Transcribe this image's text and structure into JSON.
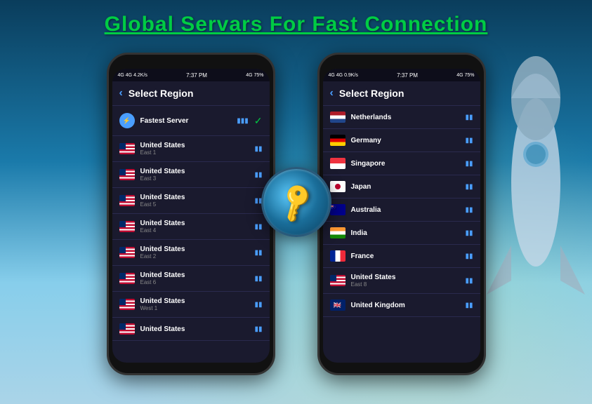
{
  "title": "Global Servars For Fast Connection",
  "phone_left": {
    "status": {
      "left": "4G  4G  4.2K/s",
      "time": "7:37 PM",
      "right": "4G  75%"
    },
    "header": {
      "back": "‹",
      "title": "Select Region"
    },
    "items": [
      {
        "id": "fastest",
        "name": "Fastest Server",
        "sub": "",
        "flag": "speed",
        "active": true
      },
      {
        "id": "us-east1",
        "name": "United States",
        "sub": "East 1",
        "flag": "us"
      },
      {
        "id": "us-east3",
        "name": "United States",
        "sub": "East 3",
        "flag": "us"
      },
      {
        "id": "us-east5",
        "name": "United States",
        "sub": "East 5",
        "flag": "us"
      },
      {
        "id": "us-east4",
        "name": "United States",
        "sub": "East 4",
        "flag": "us"
      },
      {
        "id": "us-east2",
        "name": "United States",
        "sub": "East 2",
        "flag": "us"
      },
      {
        "id": "us-east6",
        "name": "United States",
        "sub": "East 6",
        "flag": "us"
      },
      {
        "id": "us-west1",
        "name": "United States",
        "sub": "West 1",
        "flag": "us"
      },
      {
        "id": "us-more",
        "name": "United States",
        "sub": "",
        "flag": "us"
      }
    ]
  },
  "phone_right": {
    "status": {
      "left": "4G  4G  0.9K/s",
      "time": "7:37 PM",
      "right": "4G  75%"
    },
    "header": {
      "back": "‹",
      "title": "Select Region"
    },
    "items": [
      {
        "id": "nl",
        "name": "Netherlands",
        "sub": "",
        "flag": "nl"
      },
      {
        "id": "de",
        "name": "Germany",
        "sub": "",
        "flag": "de"
      },
      {
        "id": "sg",
        "name": "Singapore",
        "sub": "",
        "flag": "sg"
      },
      {
        "id": "jp",
        "name": "Japan",
        "sub": "",
        "flag": "jp"
      },
      {
        "id": "au",
        "name": "Australia",
        "sub": "",
        "flag": "au"
      },
      {
        "id": "in",
        "name": "India",
        "sub": "",
        "flag": "in"
      },
      {
        "id": "fr",
        "name": "France",
        "sub": "",
        "flag": "fr"
      },
      {
        "id": "us-east8",
        "name": "United States",
        "sub": "East 8",
        "flag": "us"
      },
      {
        "id": "uk",
        "name": "United Kingdom",
        "sub": "",
        "flag": "uk"
      }
    ]
  },
  "key": {
    "symbol": "🔑"
  }
}
